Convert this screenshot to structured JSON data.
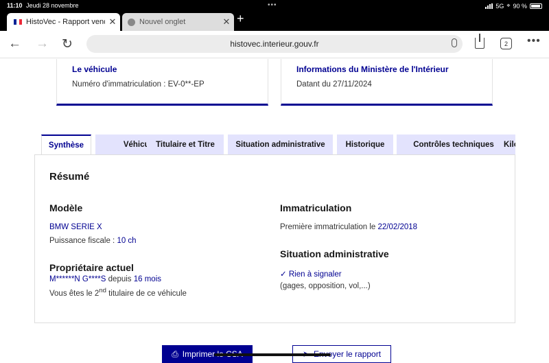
{
  "status": {
    "time": "11:10",
    "date": "Jeudi 28 novembre",
    "network": "5G",
    "battery": "90 %"
  },
  "browser": {
    "tabs": [
      {
        "title": "HistoVec - Rapport vendeur"
      },
      {
        "title": "Nouvel onglet"
      }
    ],
    "url": "histovec.interieur.gouv.fr",
    "tab_count": "2"
  },
  "cards": {
    "vehicle": {
      "title": "Le véhicule",
      "value": "Numéro d'immatriculation : EV-0**-EP"
    },
    "ministry": {
      "title": "Informations du Ministère de l'Intérieur",
      "value": "Datant du 27/11/2024"
    }
  },
  "tabs": [
    "Synthèse",
    "Véhicule",
    "Titulaire et Titre",
    "Situation administrative",
    "Historique",
    "Contrôles techniques",
    "Kilométrage"
  ],
  "summary": {
    "title": "Résumé",
    "model": {
      "heading": "Modèle",
      "name": "BMW SERIE X",
      "power_label": "Puissance fiscale : ",
      "power_value": "10 ch"
    },
    "owner": {
      "heading": "Propriétaire actuel",
      "name": "M******N G****S",
      "since_label": " depuis ",
      "since_value": "16 mois",
      "rank_prefix": "Vous êtes le ",
      "rank_num": "2",
      "rank_sup": "nd",
      "rank_suffix": " titulaire de ce véhicule"
    },
    "registration": {
      "heading": "Immatriculation",
      "label": "Première immatriculation le ",
      "date": "22/02/2018"
    },
    "admin": {
      "heading": "Situation administrative",
      "status": "Rien à signaler",
      "detail": "(gages, opposition, vol,...)"
    }
  },
  "actions": {
    "print": "Imprimer le CSA",
    "send": "Envoyer le rapport"
  },
  "colors": {
    "primary": "#000091",
    "tab_bg": "#e3e3fd"
  }
}
